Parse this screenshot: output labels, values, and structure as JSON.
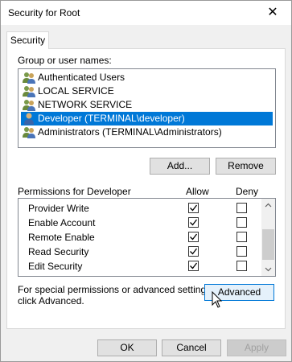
{
  "window": {
    "title": "Security for Root",
    "close_glyph": "✕"
  },
  "tab": {
    "label": "Security"
  },
  "group_list": {
    "label": "Group or user names:",
    "items": [
      {
        "name": "Authenticated Users",
        "icon": "user-group-icon",
        "selected": false
      },
      {
        "name": "LOCAL SERVICE",
        "icon": "user-group-icon",
        "selected": false
      },
      {
        "name": "NETWORK SERVICE",
        "icon": "user-group-icon",
        "selected": false
      },
      {
        "name": "Developer (TERMINAL\\developer)",
        "icon": "user-icon",
        "selected": true
      },
      {
        "name": "Administrators (TERMINAL\\Administrators)",
        "icon": "user-group-icon",
        "selected": false
      }
    ]
  },
  "buttons": {
    "add": "Add...",
    "remove": "Remove",
    "advanced": "Advanced",
    "ok": "OK",
    "cancel": "Cancel",
    "apply": "Apply"
  },
  "permissions": {
    "label": "Permissions for Developer",
    "allow_header": "Allow",
    "deny_header": "Deny",
    "rows": [
      {
        "name": "Provider Write",
        "allow": true,
        "deny": false
      },
      {
        "name": "Enable Account",
        "allow": true,
        "deny": false
      },
      {
        "name": "Remote Enable",
        "allow": true,
        "deny": false
      },
      {
        "name": "Read Security",
        "allow": true,
        "deny": false
      },
      {
        "name": "Edit Security",
        "allow": true,
        "deny": false
      }
    ]
  },
  "advanced_hint": {
    "line1": "For special permissions or advanced settings,",
    "line2": "click Advanced."
  },
  "colors": {
    "selection": "#0078d7",
    "button_face": "#e1e1e1",
    "dialog_bg": "#f0f0f0"
  }
}
